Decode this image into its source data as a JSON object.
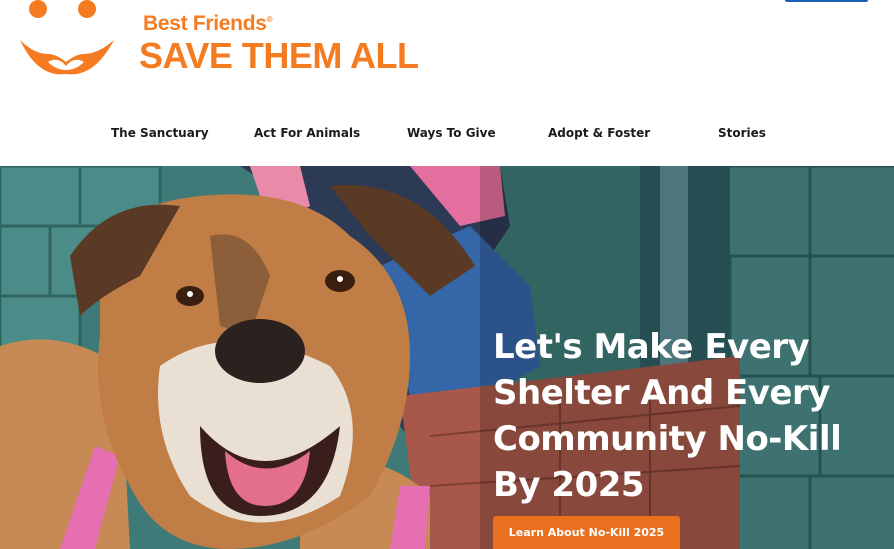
{
  "brand": {
    "line1": "Best Friends",
    "registered": "®",
    "line2": "SAVE THEM ALL",
    "logo_icon": "paw-smile-icon",
    "color": "#f47b20"
  },
  "nav": {
    "items": [
      {
        "label": "The Sanctuary"
      },
      {
        "label": "Act For Animals"
      },
      {
        "label": "Ways To Give"
      },
      {
        "label": "Adopt & Foster"
      },
      {
        "label": "Stories"
      }
    ]
  },
  "hero": {
    "title_lines": [
      "Let's Make Every",
      "Shelter And Every",
      "Community No-Kill",
      "By 2025"
    ],
    "cta_label": "Learn About No-Kill 2025",
    "cta_color": "#e8701f"
  }
}
